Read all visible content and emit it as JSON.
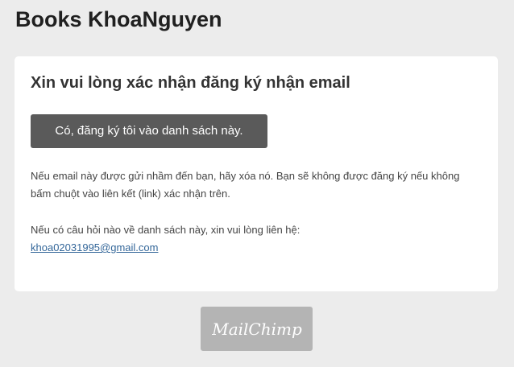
{
  "header": {
    "title": "Books KhoaNguyen"
  },
  "card": {
    "heading": "Xin vui lòng xác nhận đăng ký nhận email",
    "confirm_button_label": "Có, đăng ký tôi vào danh sách này.",
    "mistake_text": "Nếu email này được gửi nhầm đến bạn, hãy xóa nó. Bạn sẽ không được đăng ký nếu không bấm chuột vào liên kết (link) xác nhận trên.",
    "questions_text": "Nếu có câu hỏi nào về danh sách này, xin vui lòng liên hệ:",
    "contact_email": "khoa02031995@gmail.com"
  },
  "footer": {
    "logo_text": "MailChimp"
  },
  "colors": {
    "background": "#ececec",
    "button": "#5a5a5a",
    "link": "#336699",
    "badge": "#b4b4b4"
  }
}
